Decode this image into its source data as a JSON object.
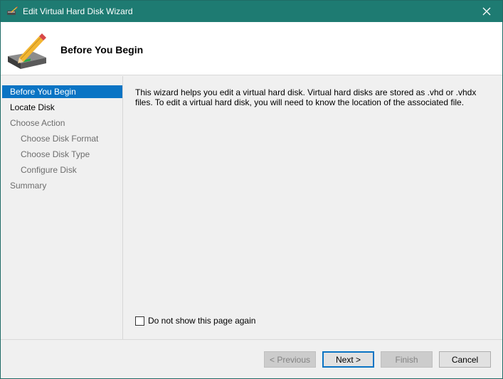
{
  "window": {
    "title": "Edit Virtual Hard Disk Wizard"
  },
  "header": {
    "title": "Before You Begin"
  },
  "nav": {
    "items": [
      {
        "label": "Before You Begin"
      },
      {
        "label": "Locate Disk"
      },
      {
        "label": "Choose Action"
      },
      {
        "label": "Choose Disk Format"
      },
      {
        "label": "Choose Disk Type"
      },
      {
        "label": "Configure Disk"
      },
      {
        "label": "Summary"
      }
    ],
    "selected": "Before You Begin"
  },
  "content": {
    "description": "This wizard helps you edit a virtual hard disk. Virtual hard disks are stored as .vhd or .vhdx files. To edit a virtual hard disk, you will need to know the location of the associated file.",
    "checkbox_label": "Do not show this page again",
    "checkbox_checked": false
  },
  "footer": {
    "previous_label": "< Previous",
    "next_label": "Next >",
    "finish_label": "Finish",
    "cancel_label": "Cancel"
  },
  "colors": {
    "titlebar": "#1e7b72",
    "selection": "#0a74c4"
  }
}
